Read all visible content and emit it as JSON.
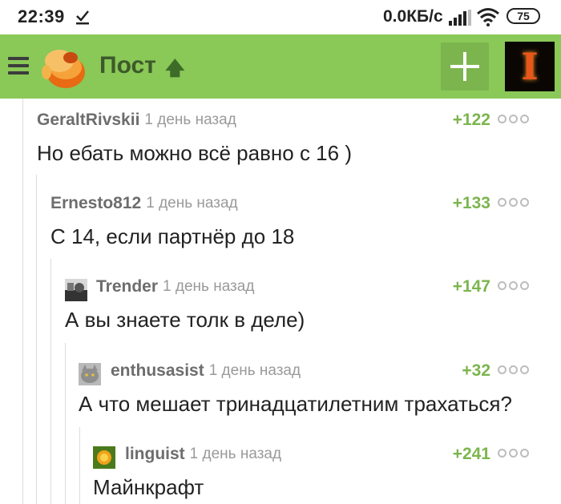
{
  "status_bar": {
    "time": "22:39",
    "net_speed": "0.0КБ/с",
    "battery": "75",
    "download_icon": "download-done-icon",
    "signal_icon": "signal-bars-icon",
    "wifi_icon": "wifi-icon"
  },
  "header": {
    "title": "Пост",
    "menu_icon": "hamburger-menu-icon",
    "up_icon": "arrow-up-icon",
    "add_icon": "plus-icon",
    "avatar_letter": "I",
    "colors": {
      "bar": "#8ac858",
      "add_button": "#7cb54e",
      "title": "#3d5a2a"
    }
  },
  "comments": [
    {
      "author": "GeraltRivskii",
      "time": "1 день назад",
      "rating": "+122",
      "text": "Но ебать можно всё равно с 16 )",
      "has_avatar": false
    },
    {
      "author": "Ernesto812",
      "time": "1 день назад",
      "rating": "+133",
      "text": "С 14, если партнёр до 18",
      "has_avatar": false
    },
    {
      "author": "Trender",
      "time": "1 день назад",
      "rating": "+147",
      "text": "А вы знаете толк в деле)",
      "has_avatar": true
    },
    {
      "author": "enthusasist",
      "time": "1 день назад",
      "rating": "+32",
      "text": "А что мешает тринадцатилетним трахаться?",
      "has_avatar": true
    },
    {
      "author": "linguist",
      "time": "1 день назад",
      "rating": "+241",
      "text": "Майнкрафт",
      "has_avatar": true
    }
  ],
  "colors": {
    "rating": "#7cb54e",
    "author": "#6d6d6d",
    "time": "#9a9a9a",
    "text": "#222222"
  }
}
